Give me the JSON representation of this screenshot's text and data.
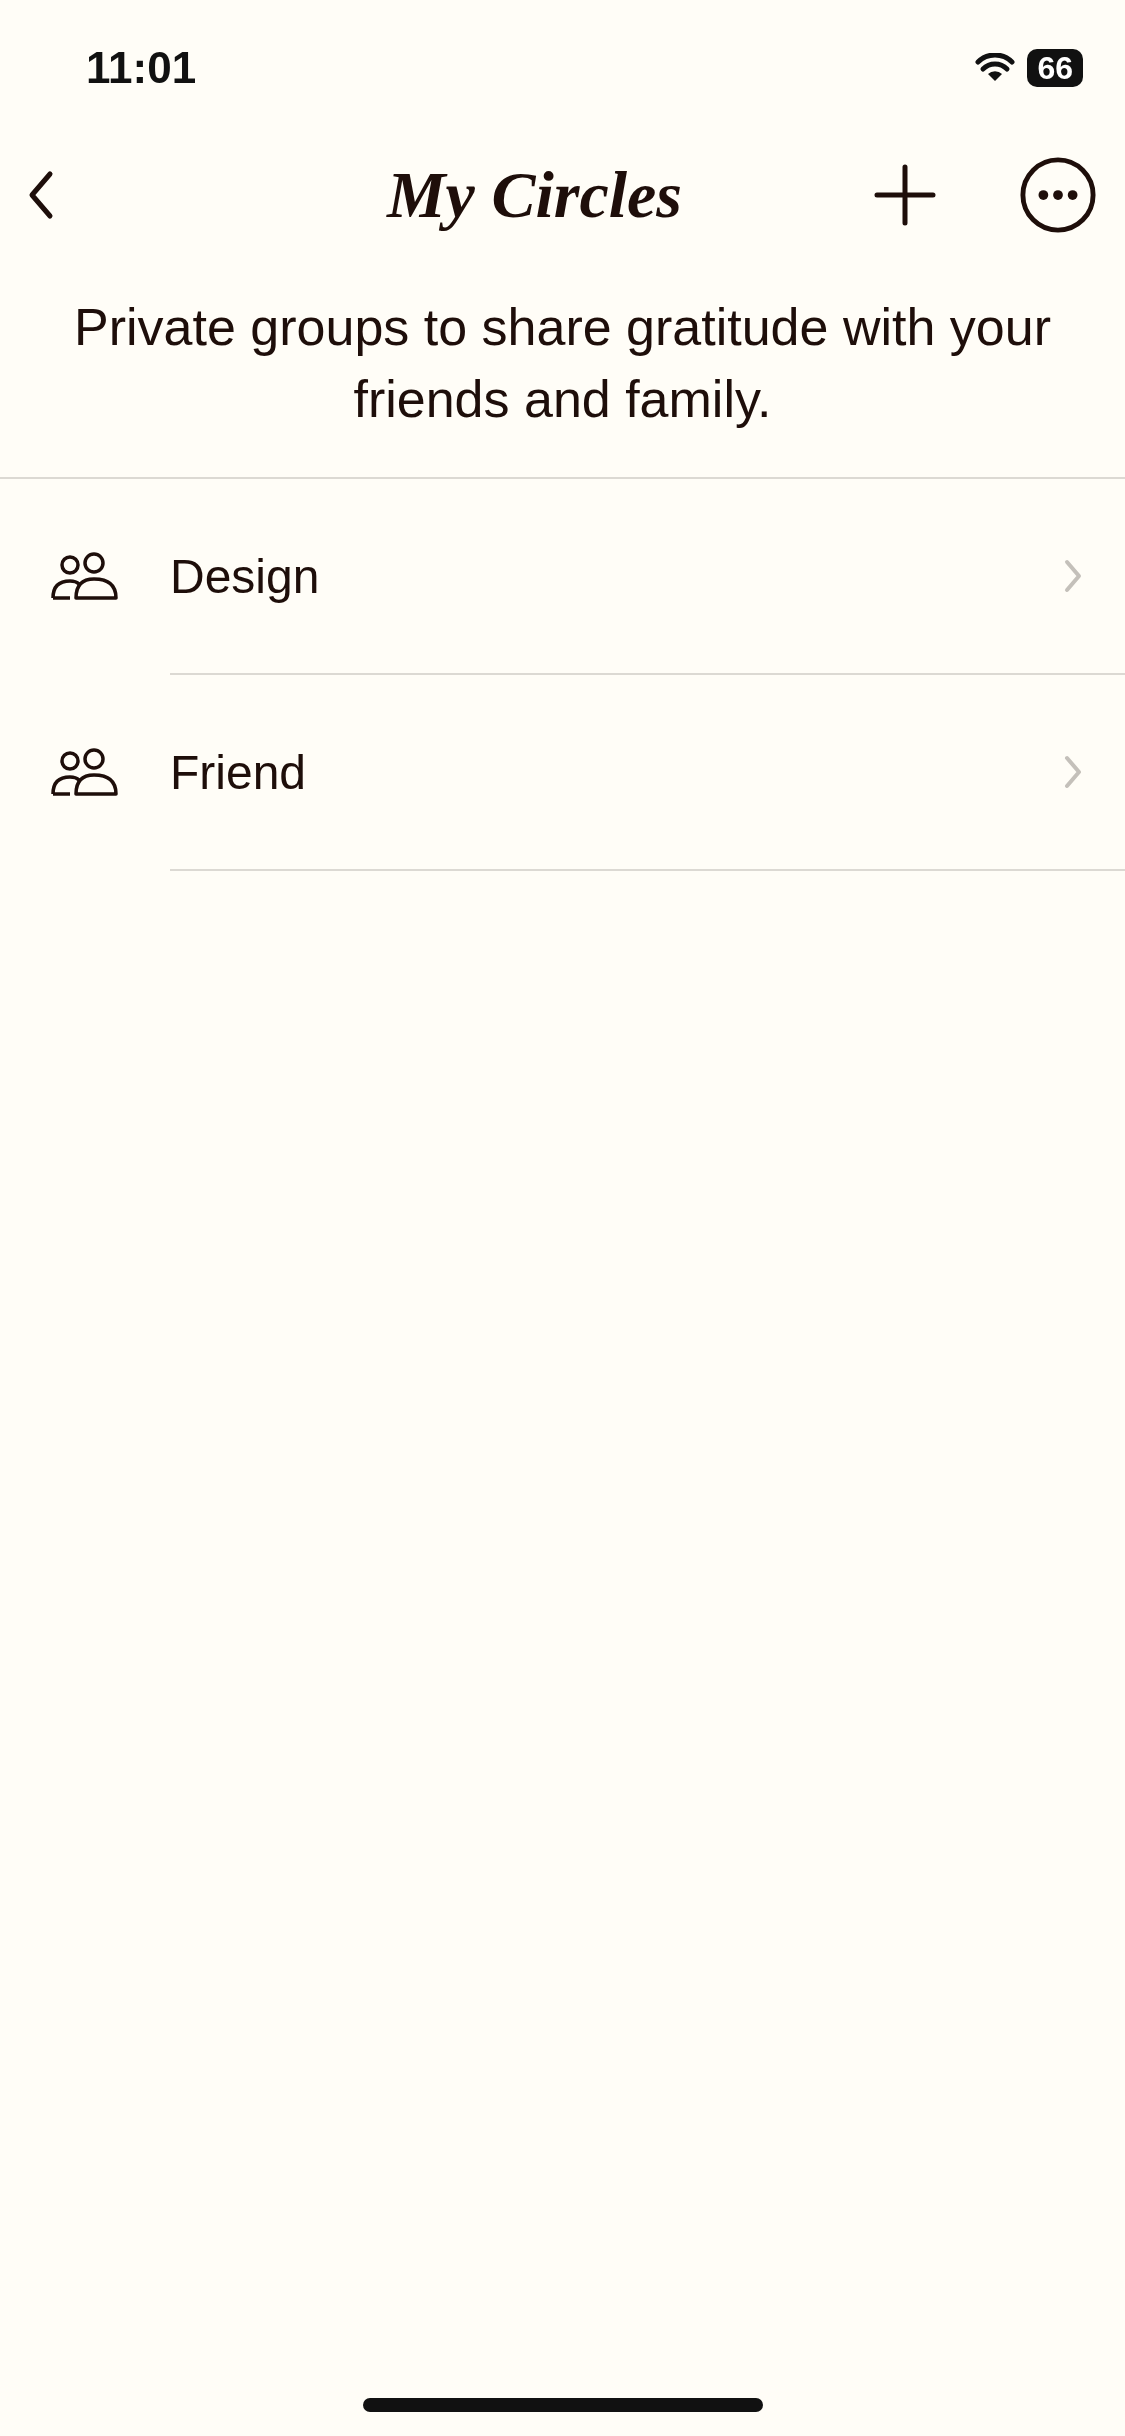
{
  "status_bar": {
    "time": "11:01",
    "battery": "66"
  },
  "nav": {
    "title": "My Circles"
  },
  "subtitle": "Private groups to share gratitude with your friends and family.",
  "circles": [
    {
      "name": "Design"
    },
    {
      "name": "Friend"
    }
  ]
}
